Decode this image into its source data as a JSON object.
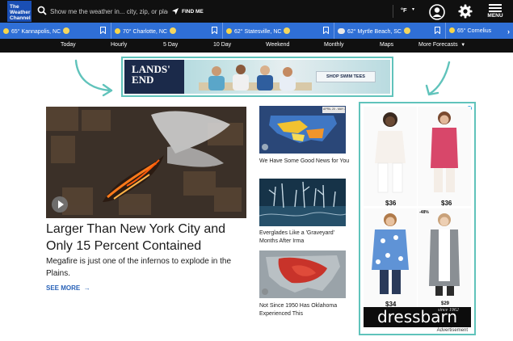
{
  "header": {
    "logo_lines": [
      "The",
      "Weather",
      "Channel"
    ],
    "search_placeholder": "Show me the weather in... city, zip, or place",
    "find_me": "FIND ME",
    "unit": "°F",
    "menu_label": "MENU"
  },
  "locations": [
    {
      "text": "65° Kannapolis, NC",
      "icon": "sun-icon"
    },
    {
      "text": "70° Charlotte, NC",
      "icon": "sun-icon"
    },
    {
      "text": "62° Statesville, NC",
      "icon": "sun-icon"
    },
    {
      "text": "62° Myrtle Beach, SC",
      "icon": "cloud-icon"
    },
    {
      "text": "65° Cornelius",
      "icon": "sun-icon"
    }
  ],
  "nav": [
    "Today",
    "Hourly",
    "5 Day",
    "10 Day",
    "Weekend",
    "Monthly",
    "Maps",
    "More Forecasts"
  ],
  "banner_ad": {
    "brand_line1": "LANDS'",
    "brand_line2": "END",
    "cta": "SHOP SWIM TEES"
  },
  "main_story": {
    "headline": "Larger Than New York City and Only 15 Percent Contained",
    "subhead": "Megafire is just one of the infernos to explode in the Plains.",
    "see_more": "SEE MORE"
  },
  "side_stories": [
    {
      "title": "We Have Some Good News for You",
      "thumb_caption": "APRIL 20 - MAY 2"
    },
    {
      "title": "Everglades Like a 'Graveyard' Months After Irma"
    },
    {
      "title": "Not Since 1950 Has Oklahoma Experienced This"
    }
  ],
  "side_ad": {
    "prices": [
      "$36",
      "$36",
      "$34",
      "$29"
    ],
    "badge": "-48%",
    "brand": "dressbarn",
    "since": "since 1962",
    "label": "Advertisement"
  },
  "colors": {
    "topbar": "#101010",
    "location_strip": "#2f6fd6",
    "accent_link": "#2a63b8",
    "ad_frame": "#60c3bb"
  }
}
